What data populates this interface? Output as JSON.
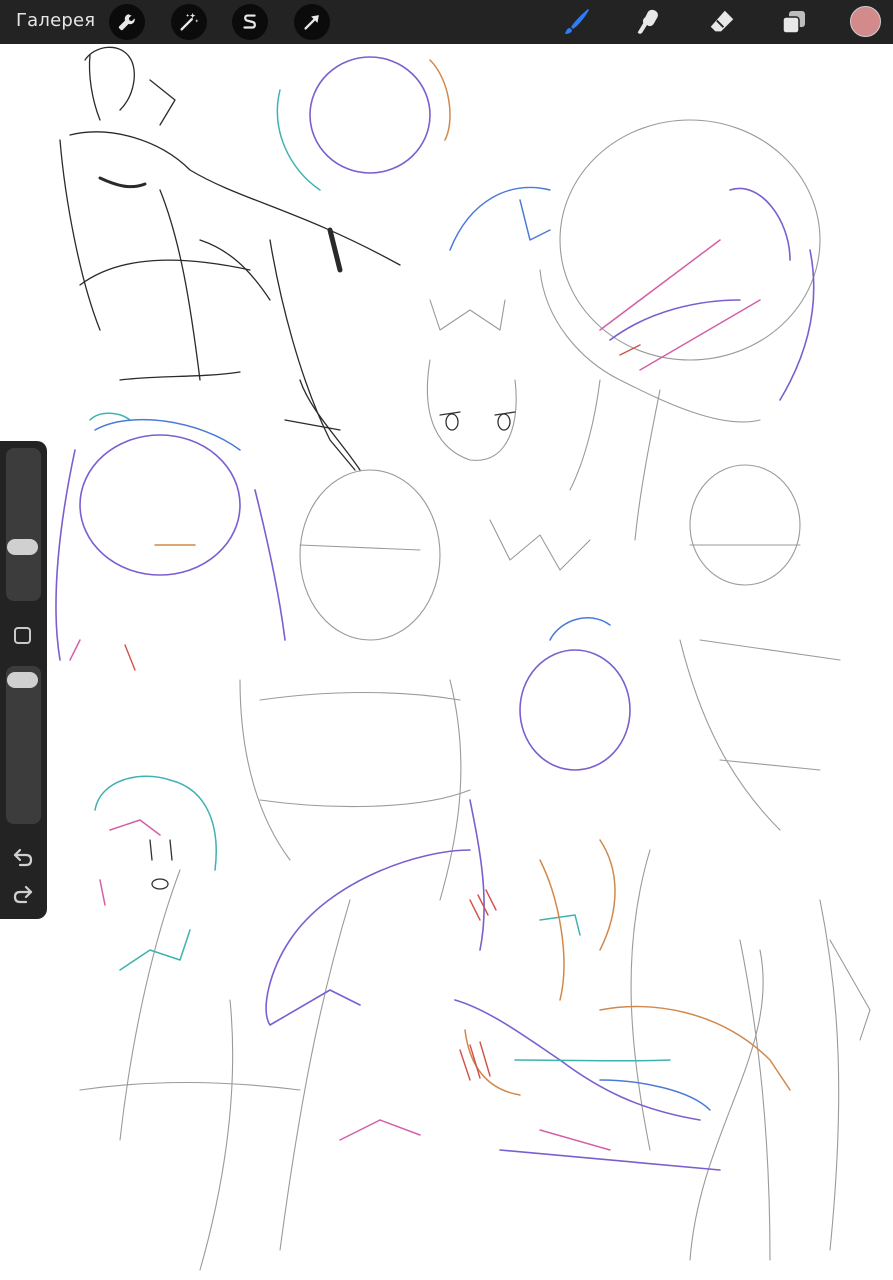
{
  "topbar": {
    "gallery_label": "Галерея",
    "left_tools": [
      "wrench-icon",
      "magic-wand-icon",
      "selection-icon",
      "transform-arrow-icon"
    ],
    "right_tools": [
      "brush-icon",
      "smudge-icon",
      "eraser-icon",
      "layers-icon"
    ],
    "active_tool": "brush",
    "accent_color": "#2f7cf6",
    "current_color": "#d28a8a"
  },
  "sidebar": {
    "brush_size_level": 0.62,
    "opacity_level": 0.0,
    "buttons": [
      "modify-square-icon",
      "undo-icon",
      "redo-icon"
    ]
  },
  "canvas": {
    "background": "#ffffff",
    "content": "sketch"
  }
}
